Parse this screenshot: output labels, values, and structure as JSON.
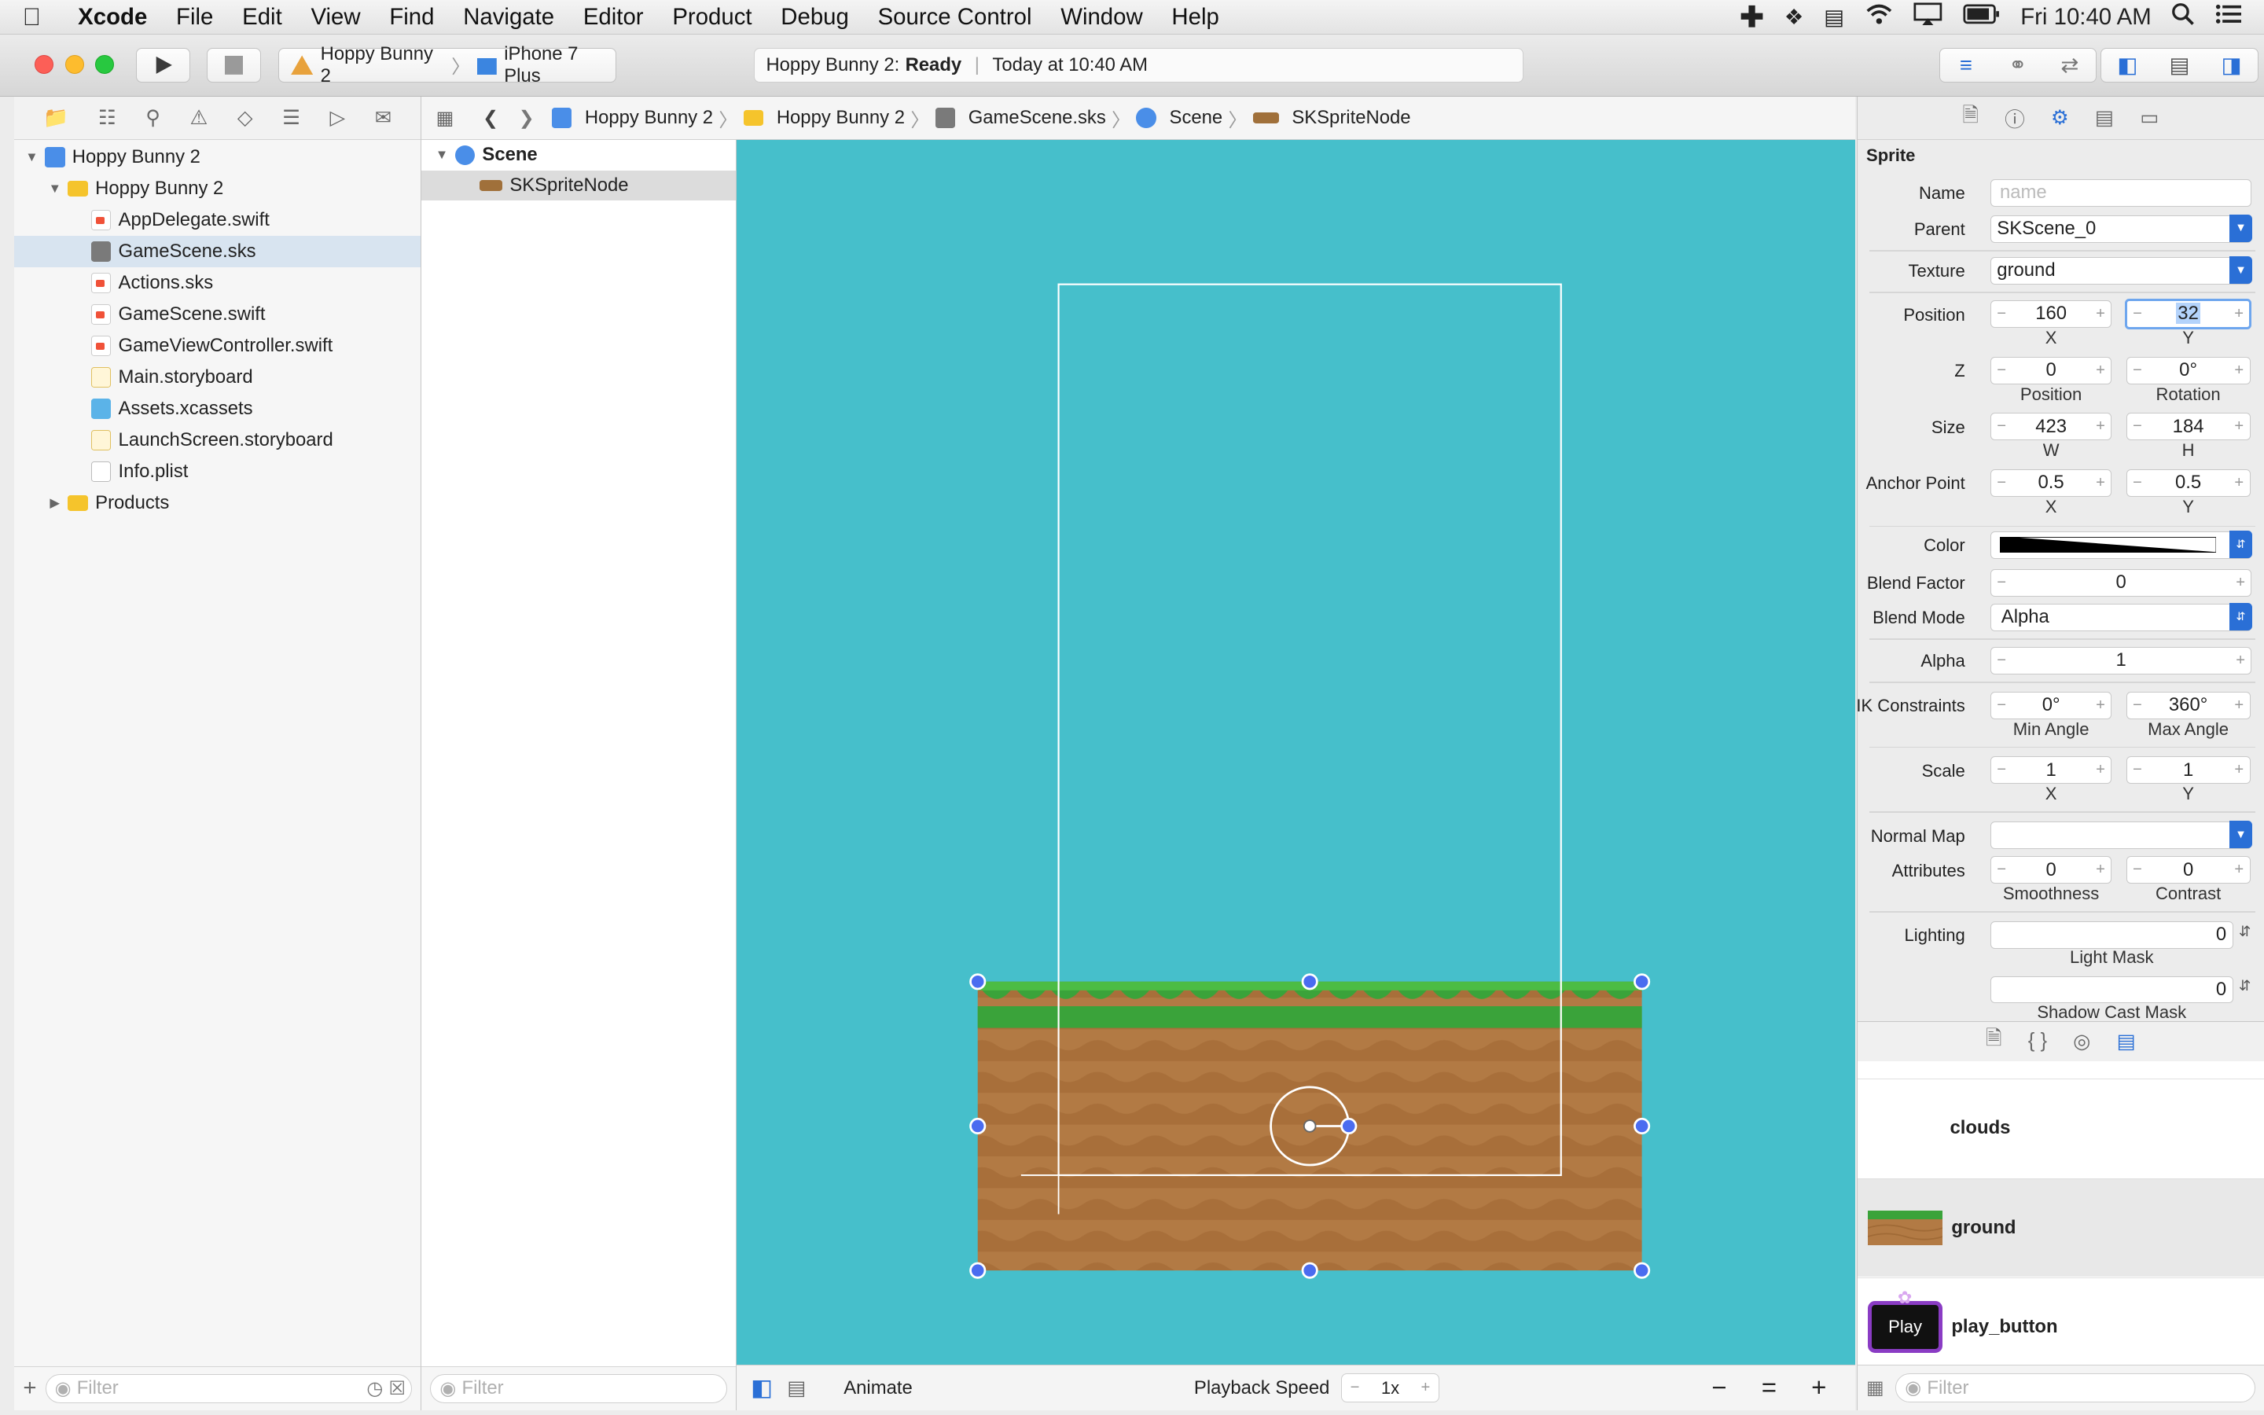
{
  "menubar": {
    "app": "Xcode",
    "items": [
      "File",
      "Edit",
      "View",
      "Find",
      "Navigate",
      "Editor",
      "Product",
      "Debug",
      "Source Control",
      "Window",
      "Help"
    ],
    "clock": "Fri 10:40 AM"
  },
  "toolbar": {
    "scheme": "Hoppy Bunny 2",
    "device": "iPhone 7 Plus",
    "status_project": "Hoppy Bunny 2:",
    "status_state": "Ready",
    "status_time": "Today at 10:40 AM"
  },
  "navigator": {
    "items": [
      {
        "label": "Hoppy Bunny 2",
        "level": 0,
        "kind": "project",
        "open": true
      },
      {
        "label": "Hoppy Bunny 2",
        "level": 1,
        "kind": "folder",
        "open": true
      },
      {
        "label": "AppDelegate.swift",
        "level": 2,
        "kind": "swift"
      },
      {
        "label": "GameScene.sks",
        "level": 2,
        "kind": "sks",
        "selected": true
      },
      {
        "label": "Actions.sks",
        "level": 2,
        "kind": "swift"
      },
      {
        "label": "GameScene.swift",
        "level": 2,
        "kind": "swift"
      },
      {
        "label": "GameViewController.swift",
        "level": 2,
        "kind": "swift"
      },
      {
        "label": "Main.storyboard",
        "level": 2,
        "kind": "sb"
      },
      {
        "label": "Assets.xcassets",
        "level": 2,
        "kind": "xcassets"
      },
      {
        "label": "LaunchScreen.storyboard",
        "level": 2,
        "kind": "sb"
      },
      {
        "label": "Info.plist",
        "level": 2,
        "kind": "plist"
      },
      {
        "label": "Products",
        "level": 1,
        "kind": "folder",
        "open": false
      }
    ],
    "filter_placeholder": "Filter"
  },
  "jumpbar": {
    "crumbs": [
      "Hoppy Bunny 2",
      "Hoppy Bunny 2",
      "GameScene.sks",
      "Scene",
      "SKSpriteNode"
    ]
  },
  "outline": {
    "root": "Scene",
    "child": "SKSpriteNode",
    "filter_placeholder": "Filter"
  },
  "editor_bottom": {
    "animate": "Animate",
    "playback_label": "Playback Speed",
    "playback_value": "1x"
  },
  "inspector": {
    "section": "Sprite",
    "name_label": "Name",
    "name_placeholder": "name",
    "parent_label": "Parent",
    "parent_value": "SKScene_0",
    "texture_label": "Texture",
    "texture_value": "ground",
    "position_label": "Position",
    "position_x": "160",
    "position_y": "32",
    "x_label": "X",
    "y_label": "Y",
    "z_label": "Z",
    "z_value": "0",
    "z_sub": "Position",
    "rotation_value": "0°",
    "rotation_sub": "Rotation",
    "size_label": "Size",
    "size_w": "423",
    "size_h": "184",
    "w_label": "W",
    "h_label": "H",
    "anchor_label": "Anchor Point",
    "anchor_x": "0.5",
    "anchor_y": "0.5",
    "color_label": "Color",
    "blend_factor_label": "Blend Factor",
    "blend_factor_value": "0",
    "blend_mode_label": "Blend Mode",
    "blend_mode_value": "Alpha",
    "alpha_label": "Alpha",
    "alpha_value": "1",
    "ik_label": "IK Constraints",
    "ik_min": "0°",
    "ik_max": "360°",
    "ik_min_sub": "Min Angle",
    "ik_max_sub": "Max Angle",
    "scale_label": "Scale",
    "scale_x": "1",
    "scale_y": "1",
    "normal_map_label": "Normal Map",
    "attributes_label": "Attributes",
    "smoothness_value": "0",
    "contrast_value": "0",
    "smoothness_sub": "Smoothness",
    "contrast_sub": "Contrast",
    "lighting_label": "Lighting",
    "light_mask_value": "0",
    "light_mask_sub": "Light Mask",
    "shadow_cast_value": "0",
    "shadow_cast_sub": "Shadow Cast Mask"
  },
  "library": {
    "items": [
      "clouds",
      "ground",
      "play_button"
    ],
    "play_text": "Play",
    "filter_placeholder": "Filter"
  },
  "colors": {
    "canvas": "#46bfcb",
    "grass": "#3aa33a",
    "dirt": "#b0763e",
    "accent": "#2a6fd6",
    "handle": "#4a6cf0"
  }
}
